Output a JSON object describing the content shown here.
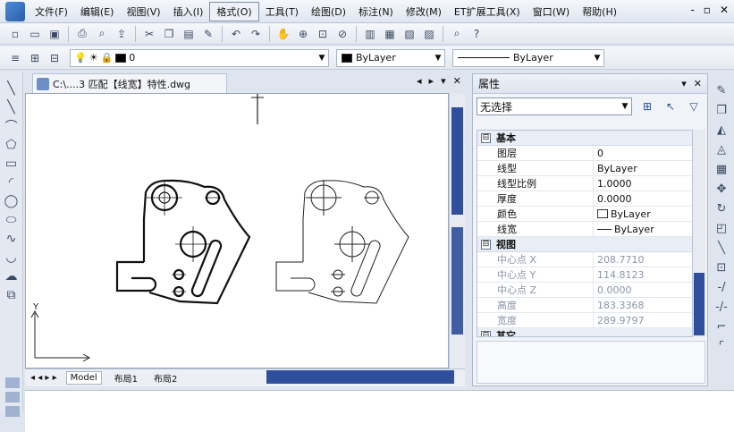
{
  "menu": [
    "文件(F)",
    "编辑(E)",
    "视图(V)",
    "插入(I)",
    "格式(O)",
    "工具(T)",
    "绘图(D)",
    "标注(N)",
    "修改(M)",
    "ET扩展工具(X)",
    "窗口(W)",
    "帮助(H)"
  ],
  "menu_active": "格式(O)",
  "window_controls": [
    "-",
    "▫",
    "✕"
  ],
  "layer_combo": {
    "value": "0"
  },
  "color_combo": {
    "value": "ByLayer"
  },
  "linetype_combo": {
    "value": "ByLayer"
  },
  "document_tab": {
    "title": "C:\\....3 匹配【线宽】特性.dwg"
  },
  "doc_controls": [
    "◂",
    "▸",
    "▾",
    "✕"
  ],
  "layout_tabs": [
    "Model",
    "布局1",
    "布局2"
  ],
  "axis": {
    "y_label": "Y"
  },
  "properties_panel": {
    "title": "属性",
    "head_controls": [
      "▾",
      "✕"
    ],
    "selection": "无选择",
    "categories": [
      {
        "name": "基本",
        "toggle": "⊟",
        "rows": [
          {
            "name": "图层",
            "value": "0"
          },
          {
            "name": "线型",
            "value": "ByLayer"
          },
          {
            "name": "线型比例",
            "value": "1.0000"
          },
          {
            "name": "厚度",
            "value": "0.0000"
          },
          {
            "name": "颜色",
            "value": "ByLayer"
          },
          {
            "name": "线宽",
            "value": "ByLayer"
          }
        ]
      },
      {
        "name": "视图",
        "toggle": "⊟",
        "rows": [
          {
            "name": "中心点 X",
            "value": "208.7710"
          },
          {
            "name": "中心点 Y",
            "value": "114.8123"
          },
          {
            "name": "中心点 Z",
            "value": "0.0000"
          },
          {
            "name": "高度",
            "value": "183.3368"
          },
          {
            "name": "宽度",
            "value": "289.9797"
          }
        ]
      },
      {
        "name": "其它",
        "toggle": "⊟"
      }
    ]
  },
  "colors": {
    "accent": "#2f4f9c",
    "canvas": "#ffffff"
  }
}
